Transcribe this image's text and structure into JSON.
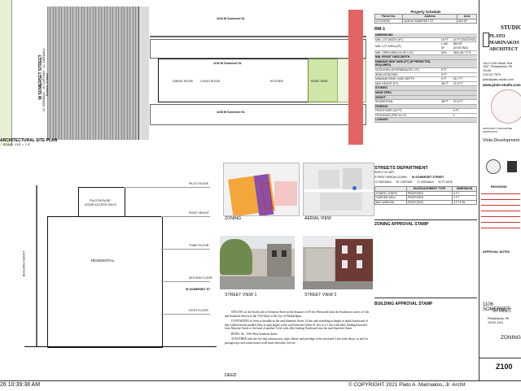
{
  "site_plan": {
    "label_top_lot": "1104 W Somerset St.",
    "label_mid_lot": "1106 W Somerset St.",
    "label_bottom_lot": "1108 W Somerset St.",
    "street_name": "W SOMERSET STREET",
    "street_sub": "12' SIDEWALK - 26' CARTWAY - 12' SIDEWALK",
    "direction": "Direction of travel",
    "rooms": [
      "DINING ROOM",
      "LIVING ROOM",
      "KITCHEN",
      "REAR YARD"
    ],
    "title": "ARCHITECTURAL SITE PLAN",
    "scale": "SCALE: 1/16\" = 1'-0\""
  },
  "elevation": {
    "pilothouse_label": "PILOTHOUSE",
    "pilothouse_sub": "(STAIR ACCESS ONLY)",
    "residential": "RESIDENTIAL",
    "street_label": "W SOMERSET ST",
    "levels": [
      "ROOF HEIGHT",
      "THIRD FLOOR",
      "SECOND FLOOR",
      "FIRST FLOOR",
      "PILOT HOUSE"
    ],
    "building_height": "BUILDING HEIGHT"
  },
  "zoning": {
    "label": "ZONING"
  },
  "aerial": {
    "label": "AERIAL VIEW"
  },
  "street_view_1": {
    "label": "STREET VIEW 1"
  },
  "street_view_2": {
    "label": "STREET VIEW 2"
  },
  "deed": {
    "p1": "SITUATE on the South side of Somerset Street at the distance of 69 feet Westward from the Southwest corner of 11th and Somerset Streets in the 37th Ward of the City of Philadelphia.",
    "p2": "CONTAINING in front or breadth on the said Somerset Street 14 feet and extending in length or depth Southward of that width between parallel lines at right angles to the said Somerset Street 61 feet to a 3 feet wide alley leading Eastward from Marvine Street to the head of another 3 feet wide alley leading Northward into the said Somerset Street.",
    "p3": "BEING No. 1106 West Somerset Street",
    "p4": "TOGETHER with the free and common use, right, liberty and privilege of the aforesaid 3 feet wide alleys, as and for passageways and watercourses at all times hereafter, forever.",
    "title": "DEED"
  },
  "property_schedule": {
    "title": "Property Schedule",
    "headers": [
      "Parcel No.",
      "Address",
      "Area"
    ],
    "row": [
      "372133000",
      "1106 W SOMERSET ST",
      "854 SF"
    ]
  },
  "zoning_table": {
    "district": "RM-1",
    "rows": [
      [
        "DIMENSIONS",
        "",
        ""
      ],
      [
        "MIN. LOT WIDTH (FT)",
        "16 FT",
        "14 FT (EXISTING)"
      ],
      [
        "MIN. LOT AREA (SF)",
        "1,440 SF",
        "854 SF (EXISTING)"
      ],
      [
        "MIN. OPEN AREA (% OF LOT)",
        "30%",
        "36% (30.7 FT)"
      ],
      [
        "MIN. FRONT YARD DEPTH",
        "",
        ""
      ],
      [
        "MINIMUM SIDE YARD (FT) (IF PERMITTED, REQUIRED)",
        "",
        ""
      ],
      [
        "DETACHED (INTERMEDIATE LOT)",
        "5 FT",
        ""
      ],
      [
        "SEMI-DETACHED",
        "5 FT",
        ""
      ],
      [
        "MINIMUM REAR YARD DEPTH",
        "9 FT",
        "18.7 FT"
      ],
      [
        "MAX HEIGHT (FT)",
        "38 FT",
        "37.5 FT"
      ],
      [
        "STORIES",
        "",
        ""
      ],
      [
        "NEAR ZERO",
        "",
        ""
      ],
      [
        "HEIGHT",
        "",
        ""
      ],
      [
        "RESIDENTIAL",
        "38 FT",
        "37.5 FT"
      ],
      [
        "PARKING",
        "",
        ""
      ],
      [
        "FRONT/SIDE (15 FT)",
        "",
        "0 FT"
      ],
      [
        "FRONTAGE (PER 10 LF)",
        "",
        "0"
      ],
      [
        "LOADING",
        "",
        ""
      ]
    ]
  },
  "streets_department": {
    "title": "STREETS DEPARTMENT",
    "sub": "RIGHT OF WAY",
    "street_label": "STREET BREAK-DOWN",
    "street_value": "W SOMERSET STREET",
    "sections": [
      "12' SIDEWALK",
      "26' CARTWAY",
      "12' SIDEWALK",
      "50 FT WIDE"
    ],
    "columns": [
      "",
      "ENCROACHMENT TYPE",
      "DIMENSION"
    ],
    "rows": [
      [
        "STAIRS / STEPS",
        "PROPOSED",
        "3 FT"
      ],
      [
        "GARDEN WALL",
        "PROPOSED",
        "4 FT"
      ],
      [
        "BAY WINDOW",
        "PROPOSED",
        "3 FT 8 IN"
      ]
    ]
  },
  "zoning_stamp": {
    "label": "ZONING APPROVAL STAMP"
  },
  "building_stamp": {
    "label": "BUILDING APPROVAL STAMP"
  },
  "firm": {
    "name_line1": "PLATO",
    "name_line2": "MARINAKOS",
    "name_line3": "ARCHITECT",
    "studio": "STUDIO",
    "address": "104 N 10th Street, Box 1057, Philadelphia, PA 19136",
    "phone": "215.247.7679",
    "email": "plato@plato-studio.com",
    "website": "www.plato-studio.com",
    "client": "Viola Development",
    "seal_text": "ARCHITECT: MALAVATHE MARINAKOS",
    "revisions_title": "REVISIONS",
    "notes_label": "APPROVAL NOTES"
  },
  "project": {
    "address_line1": "1106 SOMERSET",
    "address_line2": "STREET",
    "city": "Philadelphia, PA",
    "zip": "19133-1431",
    "sheet_title": "ZONING",
    "sheet_number": "Z100"
  },
  "footer": {
    "timestamp": "26 10:39:38 AM",
    "copyright": "© COPYRIGHT 2021  Plato A. Marinakos, Jr. Archit"
  }
}
